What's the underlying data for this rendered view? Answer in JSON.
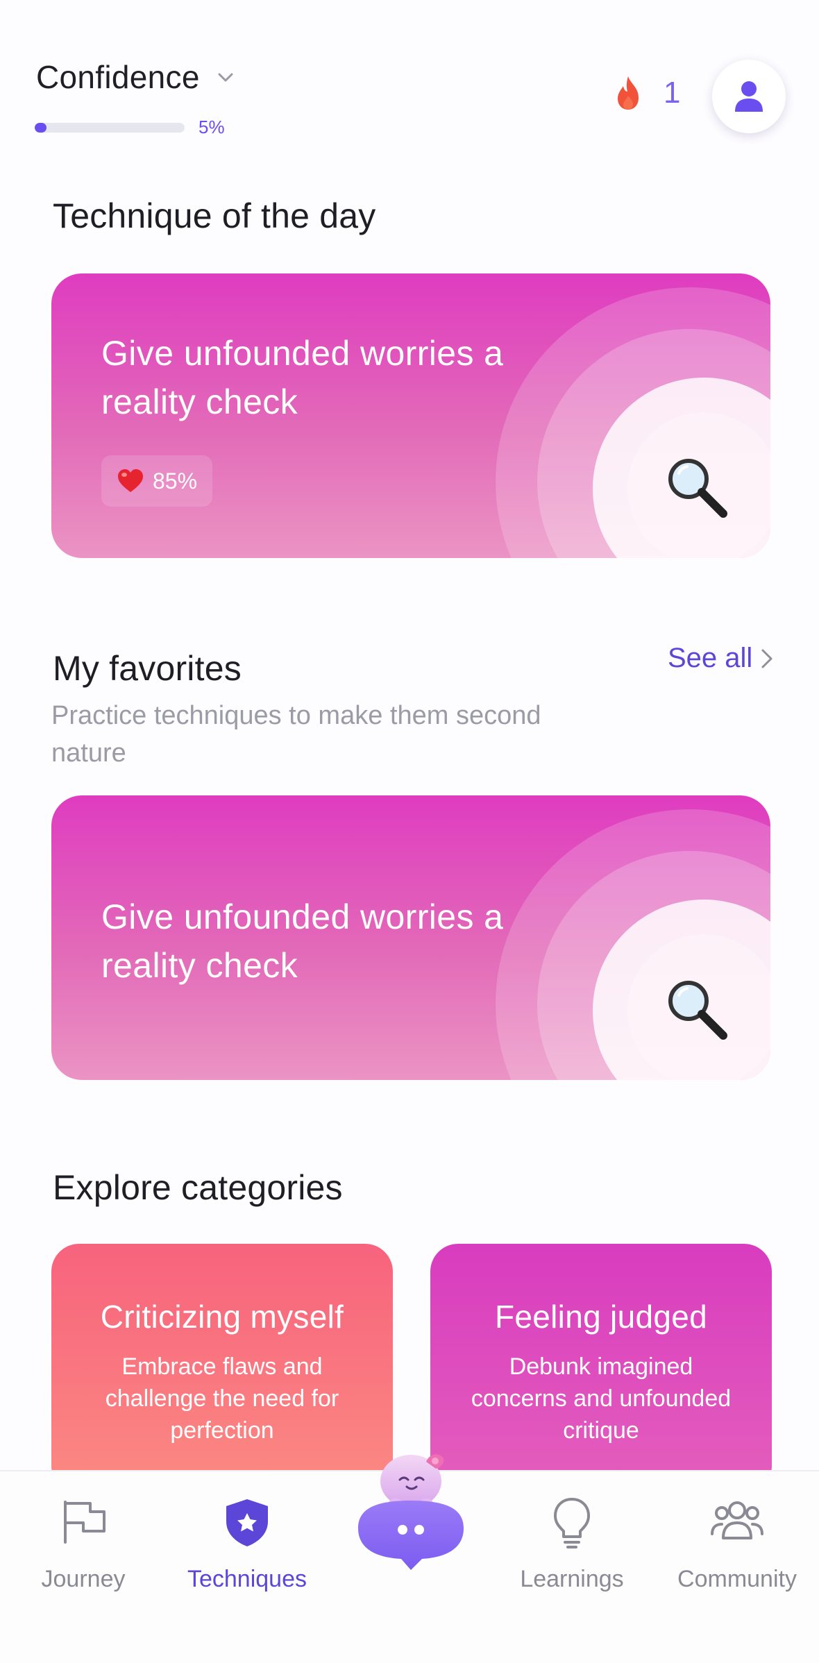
{
  "header": {
    "goal_title": "Confidence",
    "progress_percent_label": "5%",
    "progress_fraction": 0.05,
    "streak_count": "1"
  },
  "technique_of_day": {
    "section_title": "Technique of the day",
    "card_title": "Give unfounded worries a reality check",
    "rating": "85%",
    "icon": "magnifying-glass"
  },
  "favorites": {
    "section_title": "My favorites",
    "see_all_label": "See all",
    "subtitle": "Practice techniques to make them second nature",
    "card_title": "Give unfounded worries a reality check",
    "icon": "magnifying-glass"
  },
  "categories": {
    "section_title": "Explore categories",
    "items": [
      {
        "title": "Criticizing myself",
        "description": "Embrace flaws and challenge the need for perfection",
        "color": "#f7637d"
      },
      {
        "title": "Feeling judged",
        "description": "Debunk imagined concerns and unfounded critique",
        "color": "#d83cbf"
      }
    ]
  },
  "nav": {
    "items": [
      {
        "label": "Journey",
        "icon": "flag-icon"
      },
      {
        "label": "Techniques",
        "icon": "shield-star-icon",
        "active": true
      },
      {
        "label": "Learnings",
        "icon": "lightbulb-icon"
      },
      {
        "label": "Community",
        "icon": "people-icon"
      }
    ]
  },
  "colors": {
    "accent": "#5b46d8",
    "streak_flame": "#f0523a",
    "card_gradient_top": "#df3cc0"
  }
}
